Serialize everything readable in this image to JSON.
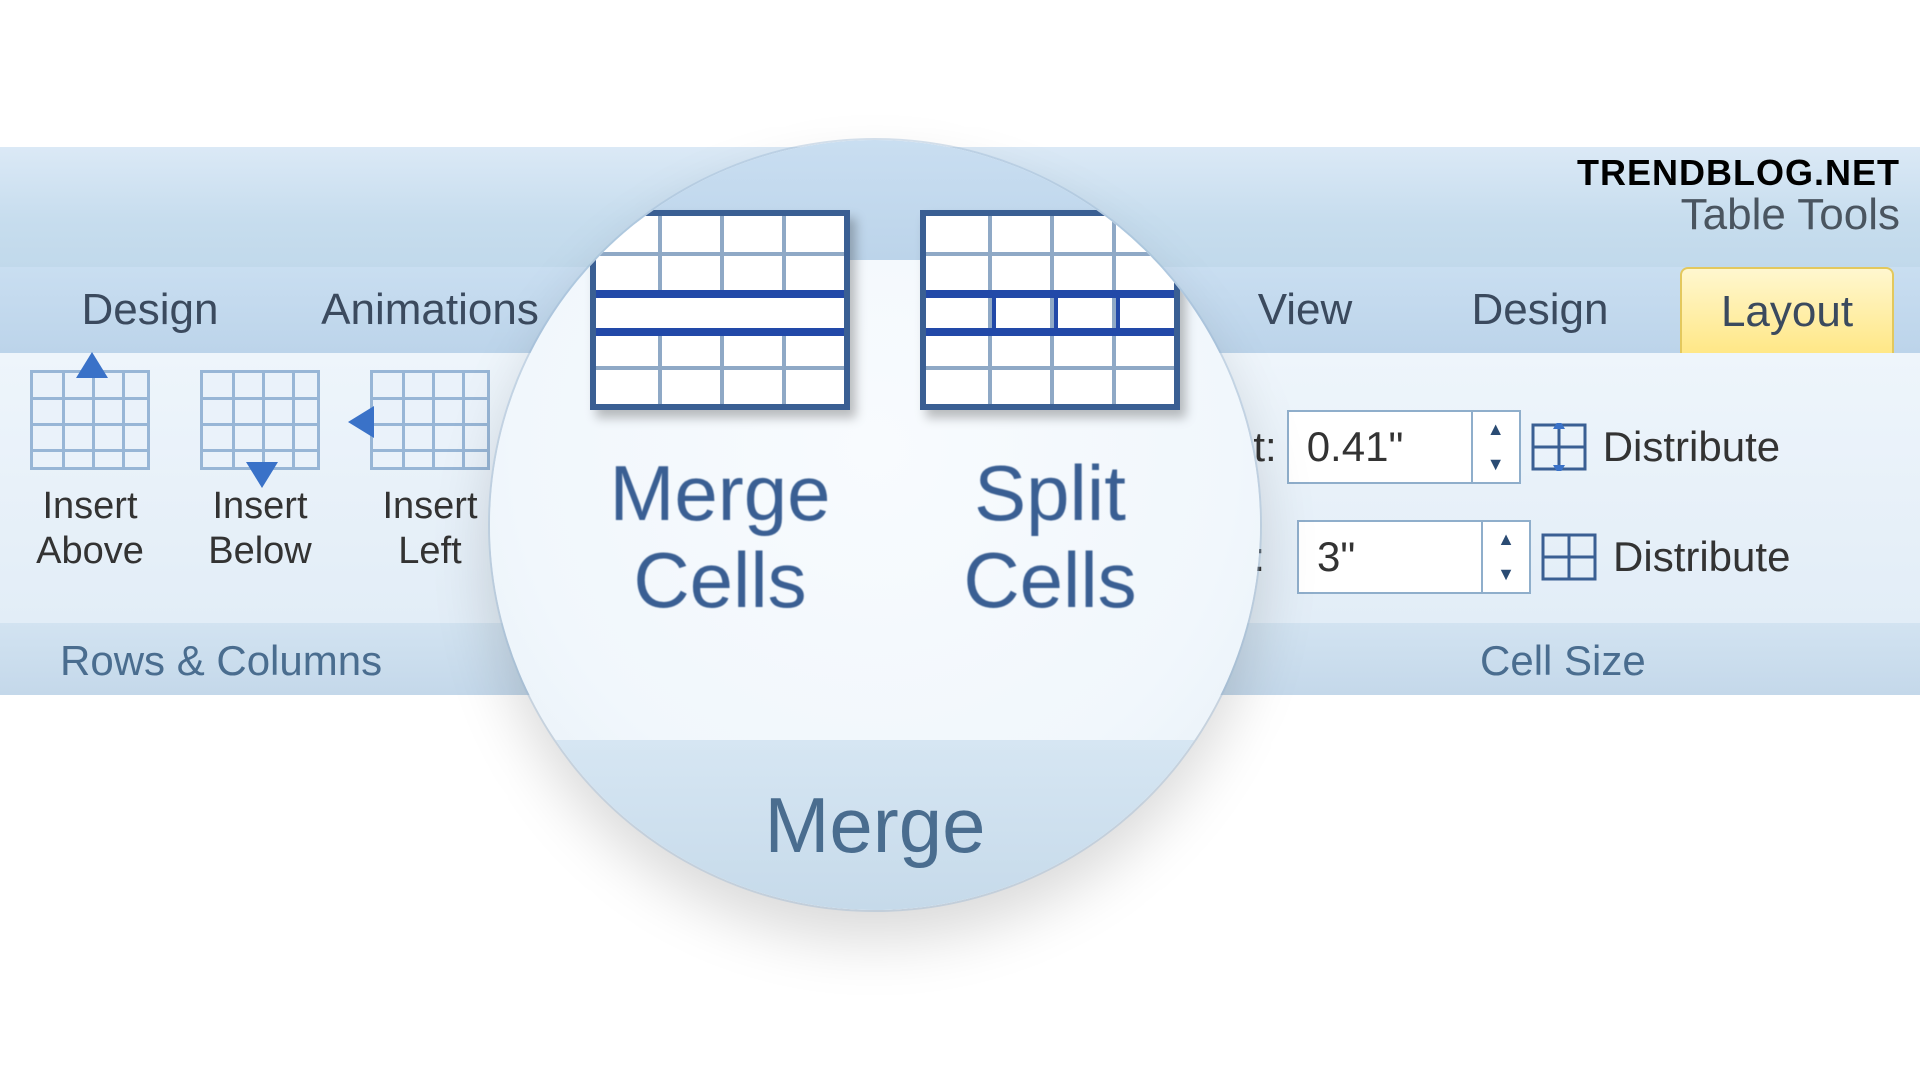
{
  "watermark": "TRENDBLOG.NET",
  "contextual_title": "Table Tools",
  "tabs": {
    "design": "Design",
    "animations": "Animations",
    "view": "View",
    "tt_design": "Design",
    "tt_layout": "Layout"
  },
  "rows_columns": {
    "insert_above": "Insert\nAbove",
    "insert_below": "Insert\nBelow",
    "insert_left": "Insert\nLeft",
    "group_label": "Rows & Columns"
  },
  "merge_group": {
    "merge_cells": "Merge\nCells",
    "split_cells": "Split\nCells",
    "group_label": "Merge"
  },
  "cell_size": {
    "height_label_partial": "ht:",
    "height_value": "0.41\"",
    "width_label_partial": "h:",
    "width_value": "3\"",
    "distribute_rows": "Distribute",
    "distribute_cols": "Distribute",
    "group_label": "Cell Size"
  }
}
